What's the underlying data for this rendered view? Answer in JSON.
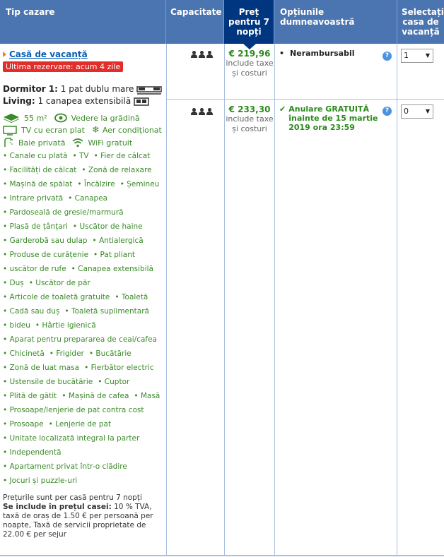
{
  "header": {
    "col_type": "Tip cazare",
    "col_capacity": "Capacitate",
    "col_price": "Preț pentru 7 nopți",
    "col_options": "Opțiunile dumneavoastră",
    "col_select": "Selectați casa de vacanță"
  },
  "property": {
    "title": "Casă de vacanță",
    "badge": "Ultima rezervare: acum 4 zile",
    "bedroom_label": "Dormitor 1:",
    "bedroom_value": "1 pat dublu mare",
    "living_label": "Living:",
    "living_value": "1 canapea extensibilă",
    "size": "55 m²",
    "view": "Vedere la grădină",
    "tv": "TV cu ecran plat",
    "ac": "Aer condiționat",
    "bath": "Baie privată",
    "wifi": "WiFi gratuit",
    "amenities": [
      [
        "Canale cu plată",
        "TV",
        "Fier de călcat"
      ],
      [
        "Facilități de călcat",
        "Zonă de relaxare"
      ],
      [
        "Mașină de spălat",
        "Încălzire",
        "Șemineu"
      ],
      [
        "Intrare privată",
        "Canapea"
      ],
      [
        "Pardoseală de gresie/marmură"
      ],
      [
        "Plasă de țânțari",
        "Uscător de haine"
      ],
      [
        "Garderobă sau dulap",
        "Antialergică"
      ],
      [
        "Produse de curățenie",
        "Pat pliant"
      ],
      [
        "uscător de rufe",
        "Canapea extensibilă"
      ],
      [
        "Duș",
        "Uscător de păr"
      ],
      [
        "Articole de toaletă gratuite",
        "Toaletă"
      ],
      [
        "Cadă sau duș",
        "Toaletă suplimentară"
      ],
      [
        "bideu",
        "Hârtie igienică"
      ],
      [
        "Aparat pentru prepararea de ceai/cafea"
      ],
      [
        "Chicinetă",
        "Frigider",
        "Bucătărie"
      ],
      [
        "Zonă de luat masa",
        "Fierbător electric"
      ],
      [
        "Ustensile de bucătărie",
        "Cuptor"
      ],
      [
        "Plită de gătit",
        "Mașină de cafea",
        "Masă"
      ],
      [
        "Prosoape/lenjerie de pat contra cost"
      ],
      [
        "Prosoape",
        "Lenjerie de pat"
      ],
      [
        "Unitate localizată integral la parter"
      ],
      [
        "Independentă"
      ],
      [
        "Apartament privat într-o clădire"
      ],
      [
        "Jocuri și puzzle-uri"
      ]
    ],
    "note_line1": "Prețurile sunt per casă pentru 7 nopți",
    "note_bold": "Se include în prețul casei:",
    "note_rest": " 10 % TVA, taxă de oraș de 1.50 € per persoană per noapte, Taxă de servicii proprietate de 22.00 € per sejur"
  },
  "rows": [
    {
      "price": "€ 219,96",
      "price_note": "include taxe și costuri",
      "option": "Nerambursabil",
      "select_value": "1"
    },
    {
      "price": "€ 233,30",
      "price_note": "include taxe și costuri",
      "option": "Anulare GRATUITĂ înainte de 15 martie 2019 ora 23:59",
      "select_value": "0"
    }
  ],
  "colors": {
    "header_bg": "#4b75b1",
    "header_active": "#003580",
    "price_green": "#2b8a1c",
    "badge_red": "#e12e2b",
    "link_blue": "#0a5fb4"
  }
}
